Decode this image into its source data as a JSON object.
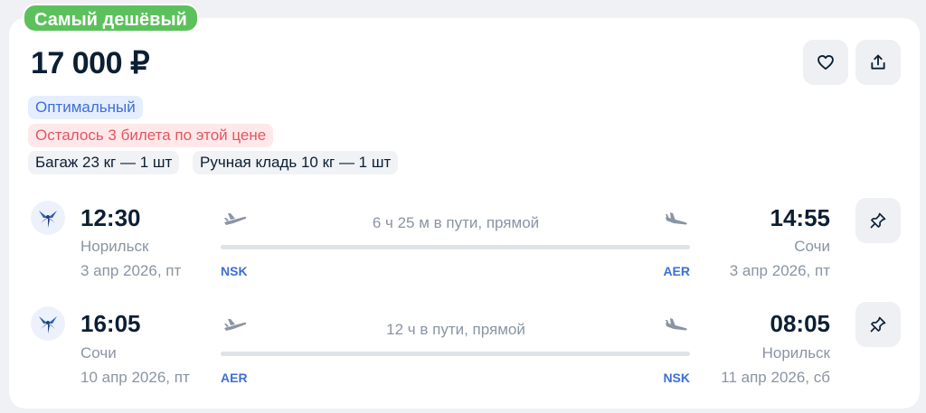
{
  "badge": "Самый дешёвый",
  "price": "17 000 ₽",
  "tags": {
    "optimal": "Оптимальный",
    "tickets_left": "Осталось 3 билета по этой цене",
    "baggage": "Багаж 23 кг — 1 шт",
    "hand_luggage": "Ручная кладь 10 кг — 1 шт"
  },
  "segments": [
    {
      "dep_time": "12:30",
      "dep_city": "Норильск",
      "dep_date": "3 апр 2026, пт",
      "duration": "6 ч 25 м в пути, прямой",
      "dep_code": "NSK",
      "arr_code": "AER",
      "arr_time": "14:55",
      "arr_city": "Сочи",
      "arr_date": "3 апр 2026, пт"
    },
    {
      "dep_time": "16:05",
      "dep_city": "Сочи",
      "dep_date": "10 апр 2026, пт",
      "duration": "12 ч в пути, прямой",
      "dep_code": "AER",
      "arr_code": "NSK",
      "arr_time": "08:05",
      "arr_city": "Норильск",
      "arr_date": "11 апр 2026, сб"
    }
  ],
  "icons": {
    "favorite": "heart-icon",
    "share": "share-icon",
    "pin": "pin-icon",
    "airline": "airline-logo-icon",
    "takeoff": "plane-takeoff-icon",
    "landing": "plane-landing-icon"
  },
  "colors": {
    "badge_green": "#5cc15c",
    "accent_blue": "#3d6fd6",
    "warning_red": "#e2565f"
  }
}
